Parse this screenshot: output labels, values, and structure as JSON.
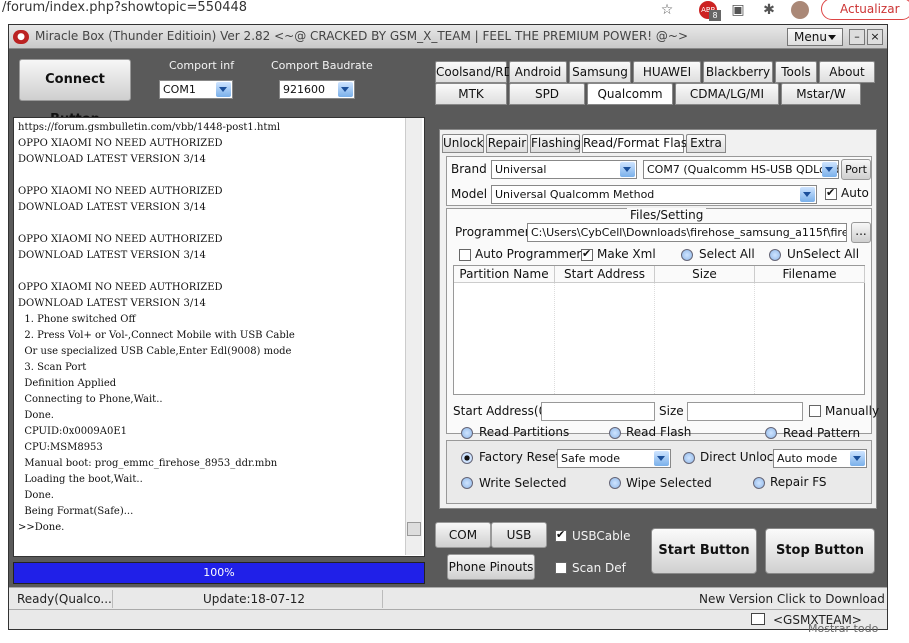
{
  "browser": {
    "url": "/forum/index.php?showtopic=550448",
    "update_label": "Actualizar",
    "badge": "8",
    "badge_icon_text": "ABP",
    "bottom_link": "Mostrar todo"
  },
  "window": {
    "title": "Miracle Box (Thunder Editioin) Ver 2.82 <~@ CRACKED BY GSM_X_TEAM | FEEL THE PREMIUM POWER! @~>",
    "menu_label": "Menu"
  },
  "left": {
    "connect_label": "Connect Button",
    "comport_label": "Comport inf",
    "comport_value": "COM1",
    "baud_label": "Comport Baudrate",
    "baud_value": "921600",
    "log_lines": [
      "https://forum.gsmbulletin.com/vbb/1448-post1.html",
      "OPPO XIAOMI NO NEED AUTHORIZED",
      "DOWNLOAD LATEST VERSION 3/14",
      "",
      "OPPO XIAOMI NO NEED AUTHORIZED",
      "DOWNLOAD LATEST VERSION 3/14",
      "",
      "OPPO XIAOMI NO NEED AUTHORIZED",
      "DOWNLOAD LATEST VERSION 3/14",
      "",
      "OPPO XIAOMI NO NEED AUTHORIZED",
      "DOWNLOAD LATEST VERSION 3/14",
      "  1. Phone switched Off",
      "  2. Press Vol+ or Vol-,Connect Mobile with USB Cable",
      "  Or use specialized USB Cable,Enter Edl(9008) mode",
      "  3. Scan Port",
      "  Definition Applied",
      "  Connecting to Phone,Wait..",
      "  Done.",
      "  CPUID:0x0009A0E1",
      "  CPU:MSM8953",
      "  Manual boot: prog_emmc_firehose_8953_ddr.mbn",
      "  Loading the boot,Wait..",
      "  Done.",
      "  Being Format(Safe)...",
      ">>Done."
    ],
    "progress_text": "100%",
    "progress": 1.0
  },
  "tabs_row1": [
    "Coolsand/RDA",
    "Android",
    "Samsung",
    "HUAWEI",
    "Blackberry",
    "Tools",
    "About"
  ],
  "tabs_row2": [
    "MTK",
    "SPD",
    "Qualcomm",
    "CDMA/LG/MI",
    "Mstar/W"
  ],
  "subtabs": [
    "Unlock",
    "Repair",
    "Flashing",
    "Read/Format Flash",
    "Extra"
  ],
  "panel": {
    "brand_label": "Brand :",
    "brand_value": "Universal",
    "port_value": "COM7 (Qualcomm HS-USB QDLoad",
    "port_btn": "Port",
    "model_label": "Model :",
    "model_value": "Universal Qualcomm Method",
    "auto_label": "Auto",
    "files_title": "Files/Setting",
    "programmer_label": "Programmer:",
    "programmer_value": "C:\\Users\\CybCell\\Downloads\\firehose_samsung_a115f\\firehose_s",
    "browse_label": "...",
    "auto_programmer": "Auto Programmer",
    "make_xml": "Make Xml",
    "select_all": "Select All",
    "unselect_all": "UnSelect All",
    "columns": [
      "Partition Name",
      "Start Address",
      "Size",
      "Filename"
    ],
    "start_addr_label": "Start Address(0x)",
    "size_label": "Size :",
    "manually_label": "Manually",
    "read_partitions": "Read Partitions",
    "read_flash": "Read Flash",
    "read_pattern": "Read Pattern",
    "factory_reset": "Factory Reset",
    "safe_mode": "Safe mode",
    "direct_unlock": "Direct Unlock",
    "auto_mode": "Auto mode",
    "write_selected": "Write Selected",
    "wipe_selected": "Wipe Selected",
    "repair_fs": "Repair FS"
  },
  "bottom": {
    "com_scan": "COM Scan",
    "usb_scan": "USB Scan",
    "usb_cable": "USBCable",
    "phone_pinouts": "Phone Pinouts",
    "scan_def": "Scan Def",
    "start": "Start Button",
    "stop": "Stop Button"
  },
  "status": {
    "ready": "Ready(Qualco...",
    "update": "Update:18-07-12",
    "new_version": "New Version Click to Download",
    "team": "<GSMXTEAM>"
  }
}
